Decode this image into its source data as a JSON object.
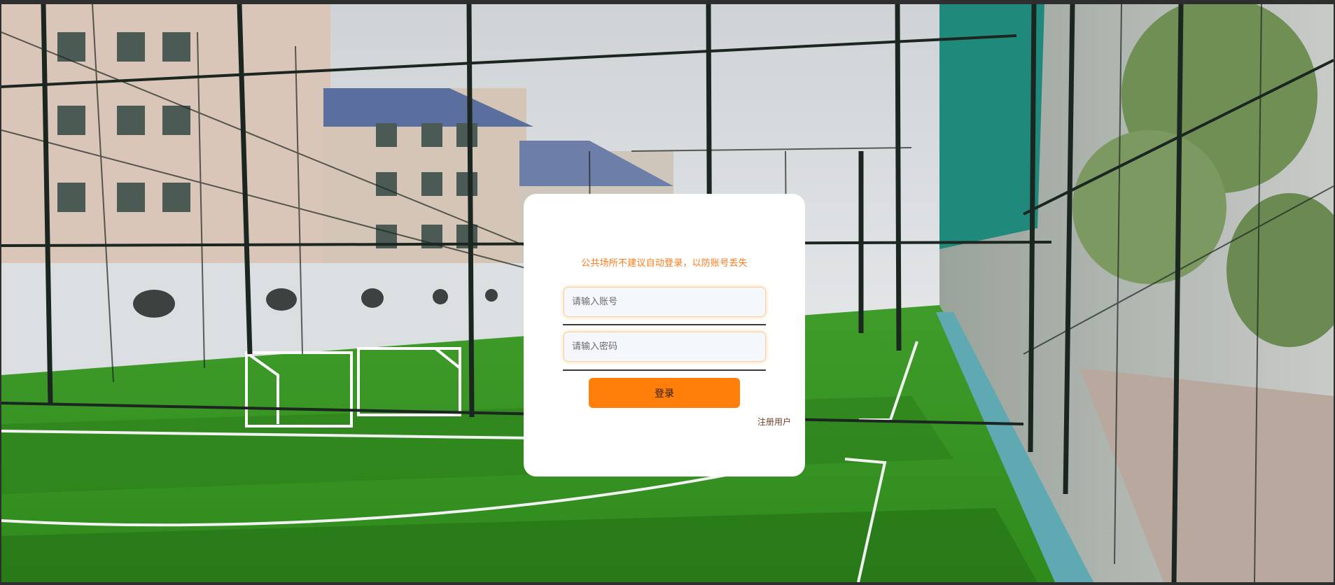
{
  "login": {
    "notice": "公共场所不建议自动登录，以防账号丢失",
    "account_placeholder": "请输入账号",
    "password_placeholder": "请输入密码",
    "login_label": "登录",
    "register_label": "注册用户"
  },
  "colors": {
    "accent": "#ff7f0a",
    "notice": "#ff7a1a",
    "card": "#ffffff"
  }
}
